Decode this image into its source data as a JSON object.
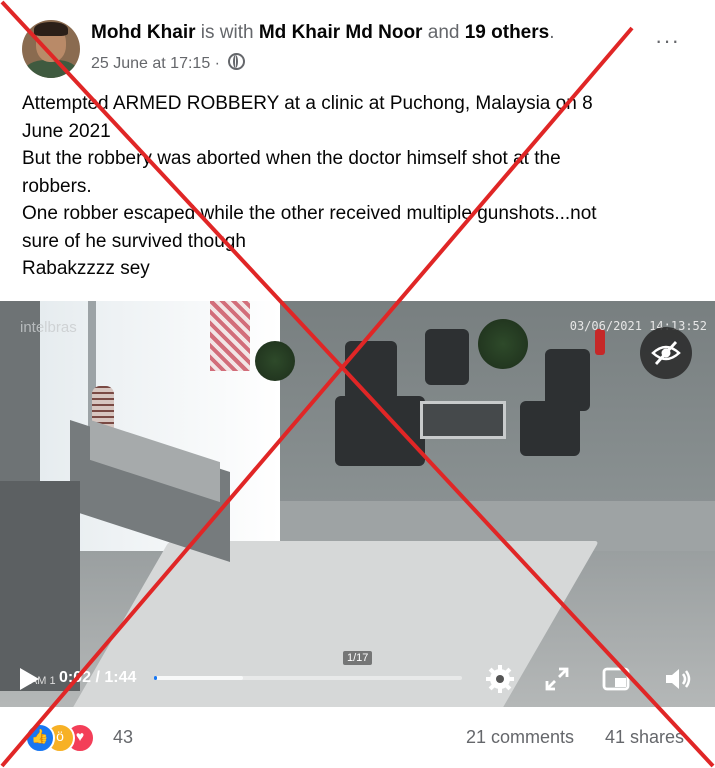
{
  "post": {
    "author": "Mohd Khair",
    "is_with": "is with",
    "tagged": "Md Khair Md Noor",
    "and": "and",
    "others": "19 others",
    "period": ".",
    "date": "25 June at 17:15 ·",
    "more": "···",
    "text_lines": [
      "Attempted ARMED ROBBERY at a clinic at Puchong, Malaysia on 8",
      "June 2021",
      "But the robbery was aborted when the doctor himself shot at the",
      "robbers.",
      "One robber escaped while the other received multiple gunshots...not",
      "sure of he survived though",
      "Rabakzzzz sey"
    ]
  },
  "video": {
    "watermark": "intelbras",
    "timestamp": "03/06/2021 14:13:52",
    "frame_counter": "1/17",
    "cam_label": "CAM 1",
    "time": "0:02 / 1:44",
    "progress": 0.01,
    "buffered": 0.29
  },
  "footer": {
    "reaction_count": "43",
    "comments": "21 comments",
    "shares": "41 shares"
  },
  "colors": {
    "accent": "#1877f2",
    "cross": "#e02626",
    "secondary_text": "#65676b"
  },
  "icons": [
    "globe-icon",
    "more-icon",
    "hide-icon",
    "play-icon",
    "settings-icon",
    "fullscreen-icon",
    "pip-icon",
    "volume-icon",
    "like-icon",
    "wow-icon",
    "love-icon"
  ]
}
